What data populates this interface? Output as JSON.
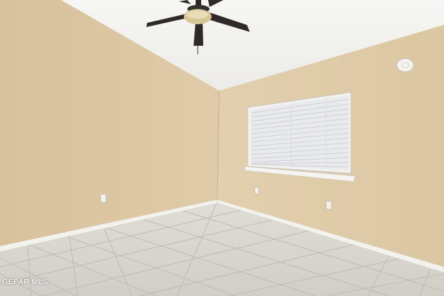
{
  "photo": {
    "watermark": "GEPAR MLS",
    "colors": {
      "left_wall": "#dcc6a2",
      "back_wall": "#e3d0ae",
      "ceiling": "#f2f1ee",
      "floor": "#d6d3cd",
      "grout": "#bdb8b0",
      "baseboard": "#f3f1ec",
      "blinds": "#ecedef",
      "fan_blade": "#2f2a28",
      "fan_light": "#d8c79a"
    },
    "icons": [
      "ceiling-fan-icon",
      "smoke-detector-icon",
      "window-icon",
      "electrical-outlet-icon"
    ]
  }
}
